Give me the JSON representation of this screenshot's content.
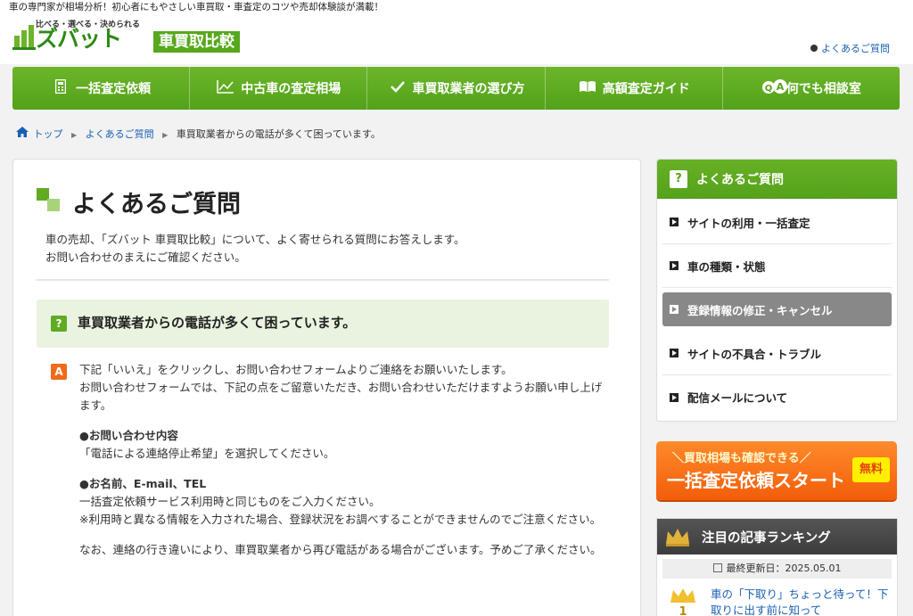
{
  "topbar": {
    "text": "車の専門家が相場分析！初心者にもやさしい車買取・車査定のコツや売却体験談が満載！"
  },
  "logo": {
    "tagline": "比べる・選べる・決められる",
    "brand": "ズバット",
    "sub": "車買取比較"
  },
  "header": {
    "faq_link": "よくあるご質問"
  },
  "nav": {
    "items": [
      {
        "label": "一括査定依頼",
        "icon": "calculator-icon"
      },
      {
        "label": "中古車の査定相場",
        "icon": "chart-icon"
      },
      {
        "label": "車買取業者の選び方",
        "icon": "check-icon"
      },
      {
        "label": "高額査定ガイド",
        "icon": "book-icon"
      },
      {
        "label": "何でも相談室",
        "icon": "qa-icon"
      }
    ]
  },
  "breadcrumb": {
    "home": "トップ",
    "faq": "よくあるご質問",
    "current": "車買取業者からの電話が多くて困っています。"
  },
  "main": {
    "title": "よくあるご質問",
    "intro1": "車の売却、「ズバット 車買取比較」について、よく寄せられる質問にお答えします。",
    "intro2": "お問い合わせのまえにご確認ください。",
    "question_badge": "?",
    "question": "車買取業者からの電話が多くて困っています。",
    "answer_badge": "A",
    "answer": {
      "p1": "下記「いいえ」をクリックし、お問い合わせフォームよりご連絡をお願いいたします。",
      "p2": "お問い合わせフォームでは、下記の点をご留意いただき、お問い合わせいただけますようお願い申し上げます。",
      "h1": "●お問い合わせ内容",
      "p3": "「電話による連絡停止希望」を選択してください。",
      "h2": "●お名前、E-mail、TEL",
      "p4": "一括査定依頼サービス利用時と同じものをご入力ください。",
      "p5": "※利用時と異なる情報を入力された場合、登録状況をお調べすることができませんのでご注意ください。",
      "p6": "なお、連絡の行き違いにより、車買取業者から再び電話がある場合がございます。予めご了承ください。"
    }
  },
  "side": {
    "faq_title": "よくあるご質問",
    "faq_items": [
      "サイトの利用・一括査定",
      "車の種類・状態",
      "登録情報の修正・キャンセル",
      "サイトの不具合・トラブル",
      "配信メールについて"
    ],
    "cta_top": "＼買取相場も確認できる／",
    "cta_main": "一括査定依頼スタート",
    "cta_free": "無料",
    "rank_title": "注目の記事ランキング",
    "rank_date": "最終更新日：2025.05.01",
    "rank_item1": "車の「下取り」ちょっと待って！下取りに出す前に知って"
  },
  "colors": {
    "green": "#55a11b",
    "orange": "#f25d0a",
    "link": "#1a5fb4"
  }
}
